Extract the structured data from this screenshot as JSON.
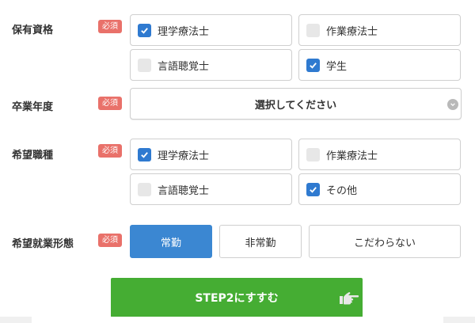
{
  "required_badge": "必須",
  "qualification": {
    "label": "保有資格",
    "options": [
      {
        "label": "理学療法士",
        "checked": true
      },
      {
        "label": "作業療法士",
        "checked": false
      },
      {
        "label": "言語聴覚士",
        "checked": false
      },
      {
        "label": "学生",
        "checked": true
      }
    ]
  },
  "graduation_year": {
    "label": "卒業年度",
    "placeholder": "選択してください"
  },
  "desired_job": {
    "label": "希望職種",
    "options": [
      {
        "label": "理学療法士",
        "checked": true
      },
      {
        "label": "作業療法士",
        "checked": false
      },
      {
        "label": "言語聴覚士",
        "checked": false
      },
      {
        "label": "その他",
        "checked": true
      }
    ]
  },
  "employment_type": {
    "label": "希望就業形態",
    "options": [
      {
        "label": "常勤",
        "selected": true
      },
      {
        "label": "非常勤",
        "selected": false
      },
      {
        "label": "こだわらない",
        "selected": false
      }
    ]
  },
  "next_button": {
    "label": "STEP2にすすむ"
  },
  "colors": {
    "badge": "#e9716a",
    "checkbox_checked": "#2f7ad0",
    "segment_active": "#3b87d2",
    "next_button": "#45ad33"
  },
  "icons": [
    "checkmark-icon",
    "chevron-down-icon",
    "pointing-hand-icon"
  ]
}
